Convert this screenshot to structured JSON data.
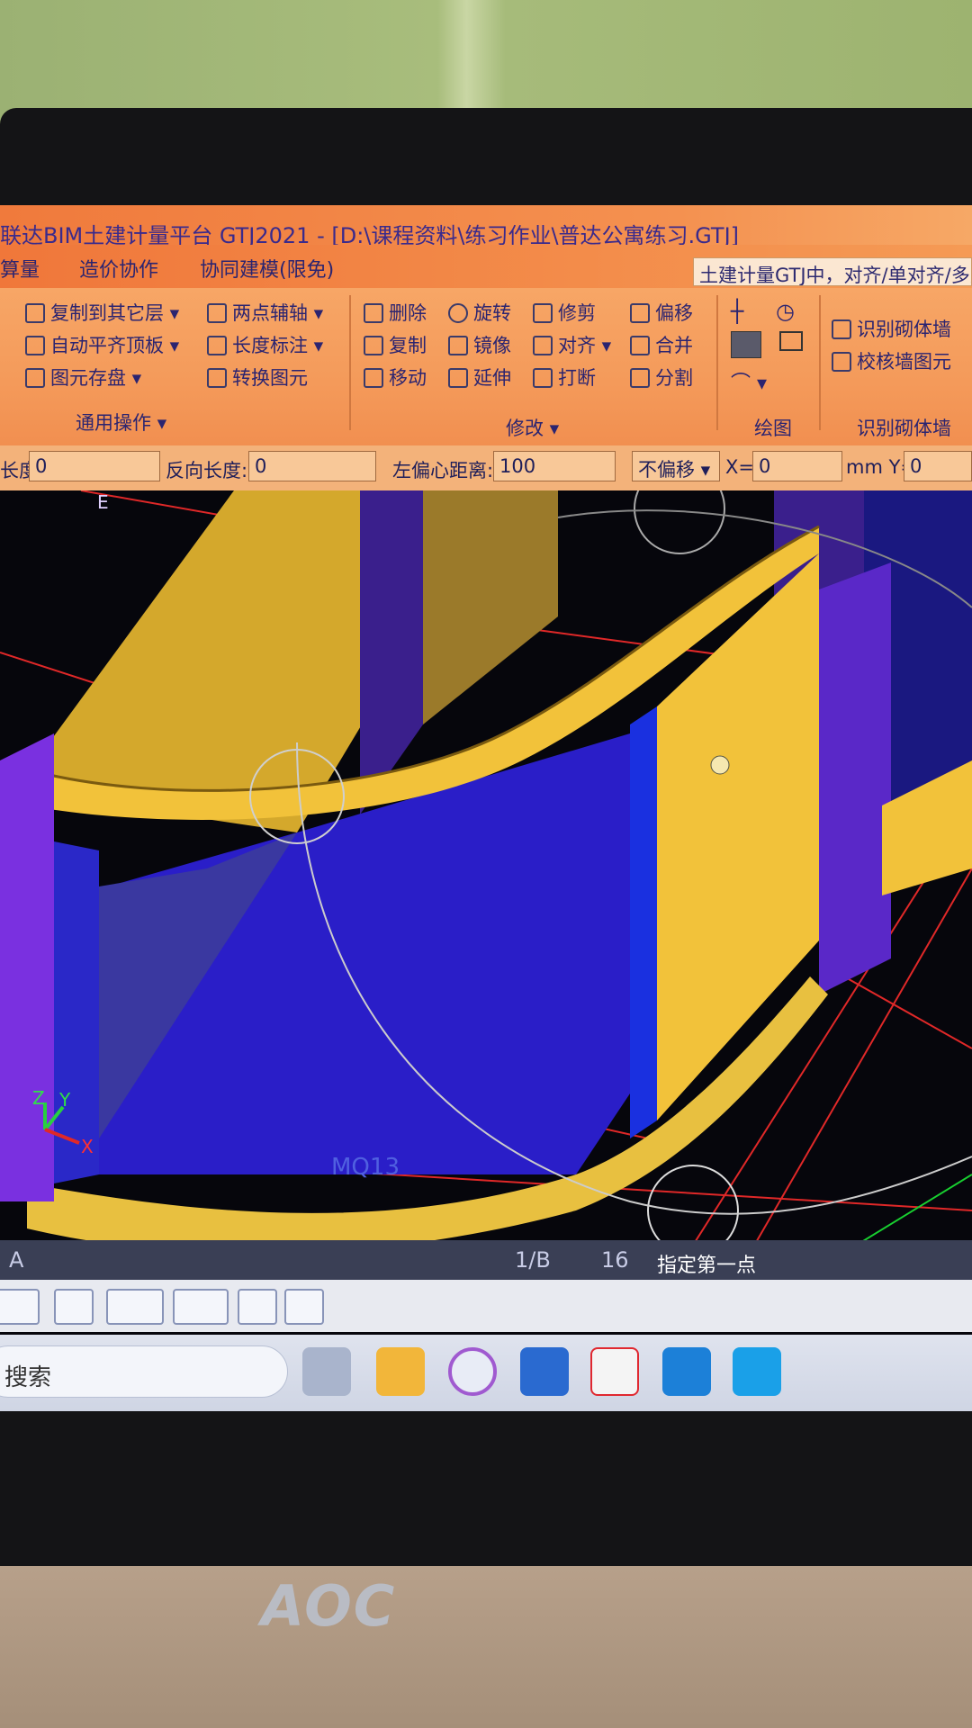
{
  "window": {
    "title": "联达BIM土建计量平台 GTJ2021 - [D:\\课程资料\\练习作业\\普达公寓练习.GTJ]",
    "menu": [
      "算量",
      "造价协作",
      "协同建模(限免)"
    ],
    "hint": "土建计量GTJ中，对齐/单对齐/多对"
  },
  "ribbon": {
    "general": {
      "items": [
        "复制到其它层",
        "自动平齐顶板",
        "图元存盘",
        "两点辅轴",
        "长度标注",
        "转换图元"
      ],
      "label": "通用操作"
    },
    "modify": {
      "items": [
        "删除",
        "旋转",
        "修剪",
        "偏移",
        "复制",
        "镜像",
        "对齐",
        "合并",
        "移动",
        "延伸",
        "打断",
        "分割"
      ],
      "label": "修改"
    },
    "draw": {
      "label": "绘图"
    },
    "recognize": {
      "items": [
        "识别砌体墙",
        "校核墙图元"
      ],
      "label": "识别砌体墙"
    }
  },
  "options": {
    "length_label": "长度:",
    "length_value": "0",
    "reverse_label": "反向长度:",
    "reverse_value": "0",
    "offset_label": "左偏心距离:",
    "offset_value": "100",
    "mode": "不偏移",
    "x_label": "X=",
    "x_value": "0",
    "unit_y": "mm Y=",
    "y_value": "0"
  },
  "canvas": {
    "label_e": "E",
    "label_mq": "MQ13",
    "axis": {
      "z": "Z",
      "y": "Y",
      "x": "X"
    }
  },
  "status": {
    "left": "A",
    "item1": "1/B",
    "item2": "16",
    "prompt": "指定第一点"
  },
  "taskbar": {
    "search": "搜索"
  },
  "monitor": {
    "brand": "AOC"
  },
  "colors": {
    "ribbon": "#f49a5a",
    "wall_yellow": "#f0c040",
    "floor_blue": "#2a1ec8",
    "column_purple": "#6a2ad8"
  }
}
